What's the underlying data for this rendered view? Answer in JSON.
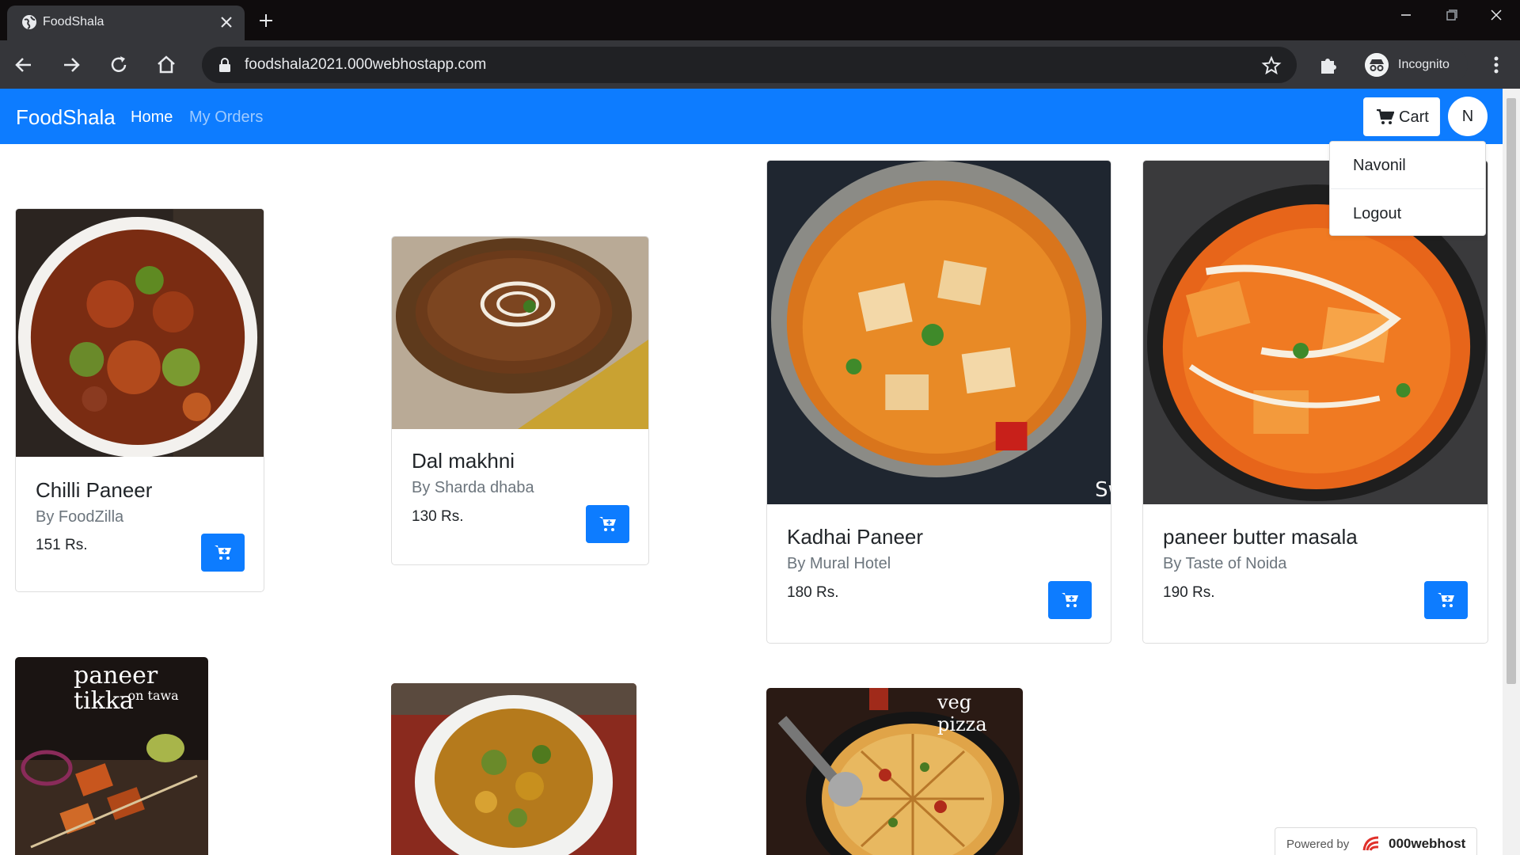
{
  "browser": {
    "tab_title": "FoodShala",
    "url": "foodshala2021.000webhostapp.com",
    "profile_label": "Incognito"
  },
  "navbar": {
    "brand": "FoodShala",
    "links": [
      "Home",
      "My Orders"
    ],
    "cart_label": "Cart",
    "avatar_initial": "N"
  },
  "user_menu": {
    "items": [
      "Navonil",
      "Logout"
    ]
  },
  "products": [
    {
      "name": "Chilli Paneer",
      "restaurant": "By FoodZilla",
      "price": "151 Rs."
    },
    {
      "name": "Dal makhni",
      "restaurant": "By Sharda dhaba",
      "price": "130 Rs."
    },
    {
      "name": "Kadhai Paneer",
      "restaurant": "By Mural Hotel",
      "price": "180 Rs."
    },
    {
      "name": "paneer butter masala",
      "restaurant": "By Taste of Noida",
      "price": "190 Rs."
    }
  ],
  "partial_images": {
    "paneer_tikka_caption": "paneer tikka",
    "paneer_tikka_sub": "- on tawa",
    "pizza_caption": "veg pizza",
    "kadhai_watermark": "Sw"
  },
  "footer_badge": {
    "prefix": "Powered by",
    "brand": "000webhost"
  },
  "colors": {
    "primary": "#0d7cff",
    "chrome_dark": "#35363a",
    "tabstrip": "#0f0c0d"
  }
}
